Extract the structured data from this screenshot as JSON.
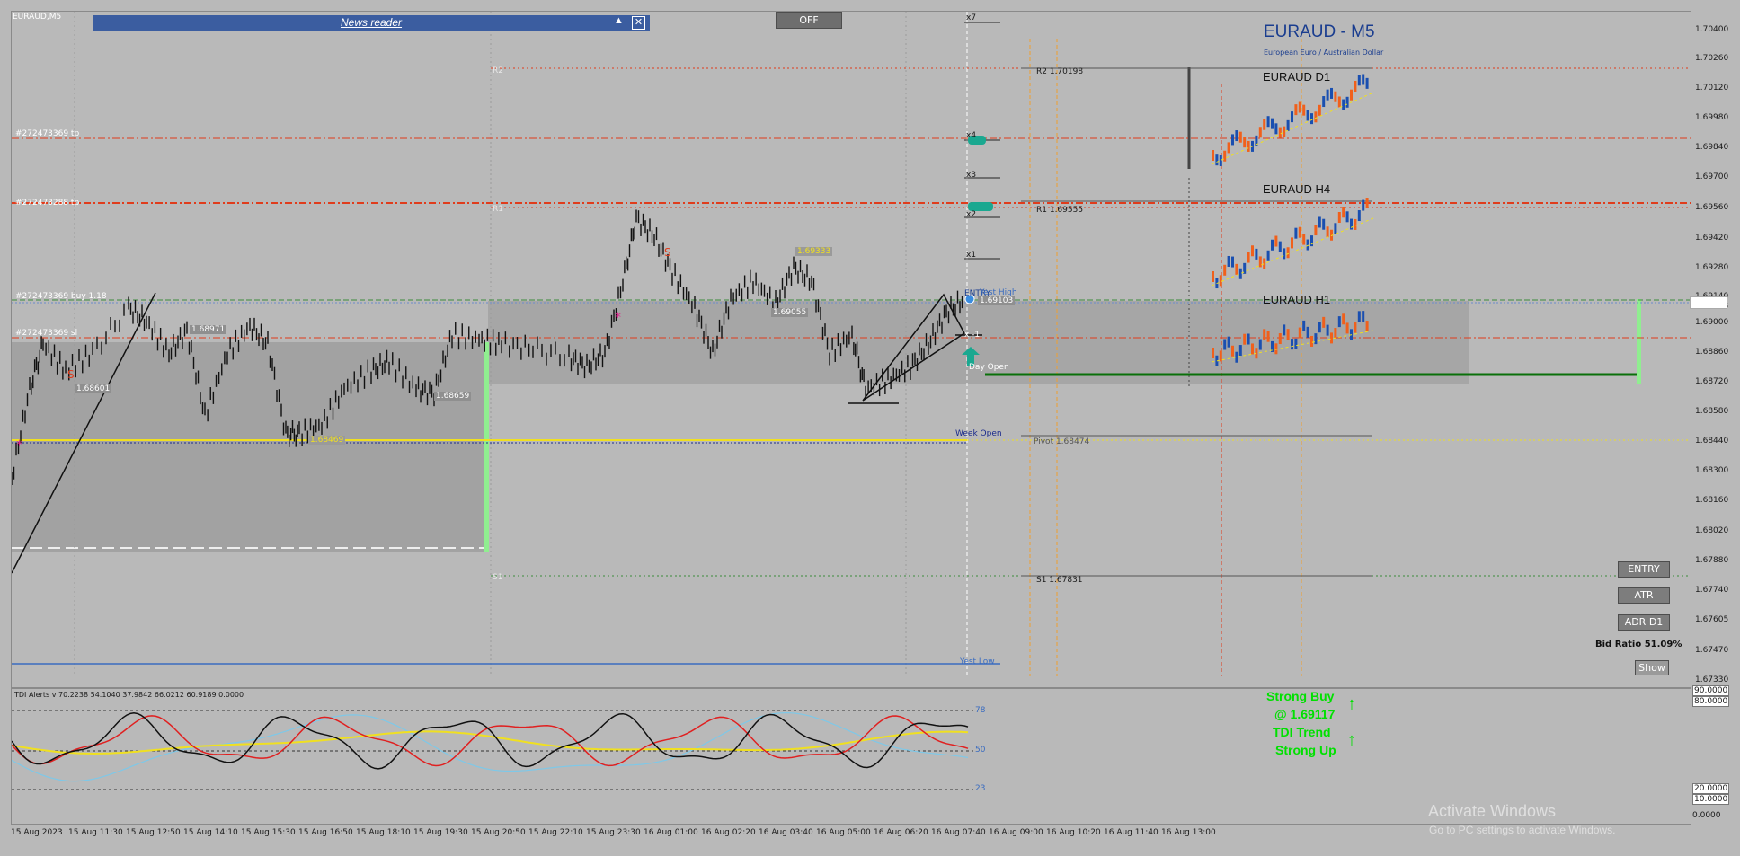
{
  "window": {
    "symbol_tab": "EURAUD,M5"
  },
  "news": {
    "title": "News reader"
  },
  "off_button": "OFF",
  "header": {
    "title": "EURAUD - M5",
    "subtitle": "European Euro / Australian Dollar"
  },
  "mini_charts": {
    "d1": "EURAUD D1",
    "h4": "EURAUD H4",
    "h1": "EURAUD H1"
  },
  "pivots": {
    "r2": "R2 1.70198",
    "r1": "R1 1.69555",
    "pivot": "Pivot 1.68474",
    "s1": "S1 1.67831"
  },
  "pivot_short": {
    "r2": "R2",
    "r1": "R1",
    "s1": "S1",
    "p": "Pivot"
  },
  "order_lines": {
    "tp1": "#272473369 tp",
    "tp2": "#272473288 tp",
    "buy": "#272473369 buy 1.18",
    "sl": "#272473369 sl"
  },
  "levels": {
    "x7": "x7",
    "x4": "x4",
    "x3": "x3",
    "x2": "x2",
    "x1": "x1",
    "entry": "ENTRY",
    "yest_high": "Yest High",
    "day_open": "Day Open",
    "week_open": "Week Open",
    "yest_low": "Yest Low",
    "x_neg": "x -1"
  },
  "chart_labels": {
    "l1": "1.68601",
    "l2": "1.68971",
    "l3": "1.68659",
    "l4": "1.68469",
    "l5": "1.69333",
    "l6": "1.69055",
    "l7": "1.69103",
    "l8": "1.68474",
    "l9": "1.68494"
  },
  "buttons": {
    "entry": "ENTRY",
    "atr": "ATR",
    "adr": "ADR D1",
    "show": "Show"
  },
  "bid_ratio": "Bid Ratio 51.09%",
  "signals": {
    "strong_buy": "Strong Buy",
    "price": "@ 1.69117",
    "tdi_trend": "TDI Trend",
    "strong_up": "Strong Up"
  },
  "tdi": {
    "title": "TDI Alerts v 70.2238 54.1040 37.9842 66.0212 60.9189 0.0000",
    "l78": "78",
    "l50": "50",
    "l23": "23"
  },
  "price_axis": [
    "1.70400",
    "1.70260",
    "1.70120",
    "1.69980",
    "1.69840",
    "1.69700",
    "1.69560",
    "1.69420",
    "1.69280",
    "1.69140",
    "1.69103",
    "1.69000",
    "1.68860",
    "1.68720",
    "1.68580",
    "1.68440",
    "1.68300",
    "1.68160",
    "1.68020",
    "1.67880",
    "1.67740",
    "1.67605",
    "1.67470",
    "1.67330"
  ],
  "sub_axis": [
    "90.0000",
    "80.0000",
    "20.0000",
    "10.0000",
    "0.0000"
  ],
  "time_axis": [
    "15 Aug 2023",
    "15 Aug 11:30",
    "15 Aug 12:50",
    "15 Aug 14:10",
    "15 Aug 15:30",
    "15 Aug 16:50",
    "15 Aug 18:10",
    "15 Aug 19:30",
    "15 Aug 20:50",
    "15 Aug 22:10",
    "15 Aug 23:30",
    "16 Aug 01:00",
    "16 Aug 02:20",
    "16 Aug 03:40",
    "16 Aug 05:00",
    "16 Aug 06:20",
    "16 Aug 07:40",
    "16 Aug 09:00",
    "16 Aug 10:20",
    "16 Aug 11:40",
    "16 Aug 13:00"
  ],
  "watermark": {
    "line1": "Activate Windows",
    "line2": "Go to PC settings to activate Windows."
  },
  "colors": {
    "buy": "#00e000",
    "resistance": "#e03c1c",
    "pivot_yellow": "#f0e020",
    "news_bar": "#3b5da0",
    "title_blue": "#1a3d8f"
  }
}
